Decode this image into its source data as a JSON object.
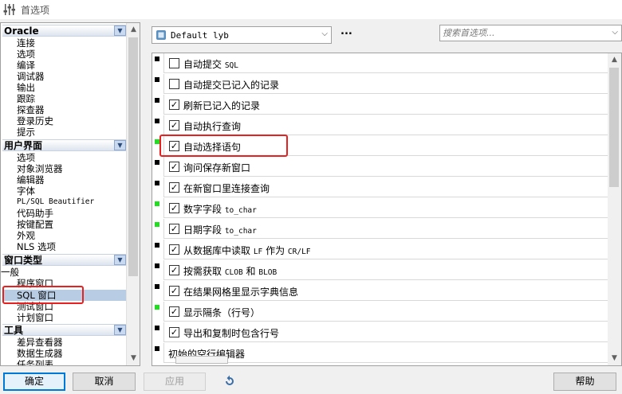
{
  "window": {
    "title": "首选项"
  },
  "tree": {
    "groups": [
      {
        "label": "Oracle",
        "items": [
          "连接",
          "选项",
          "编译",
          "调试器",
          "输出",
          "跟踪",
          "探查器",
          "登录历史",
          "提示"
        ]
      },
      {
        "label": "用户界面",
        "items": [
          "选项",
          "对象浏览器",
          "编辑器",
          "字体",
          "PL/SQL Beautifier",
          "代码助手",
          "按键配置",
          "外观",
          "NLS 选项"
        ]
      },
      {
        "label": "窗口类型",
        "sub": "一般",
        "items": [
          "程序窗口",
          "SQL 窗口",
          "测试窗口",
          "计划窗口"
        ],
        "selected": "SQL 窗口"
      },
      {
        "label": "工具",
        "items": [
          "差异查看器",
          "数据生成器",
          "任务列表"
        ]
      }
    ]
  },
  "profile": {
    "selected": "Default lyb",
    "more": "..."
  },
  "search": {
    "placeholder": "搜索首选项..."
  },
  "options": [
    {
      "label": "自动提交 SQL",
      "checked": false,
      "marker": "black"
    },
    {
      "label": "自动提交已记入的记录",
      "checked": false,
      "marker": "black"
    },
    {
      "label": "刷新已记入的记录",
      "checked": true,
      "marker": "black"
    },
    {
      "label": "自动执行查询",
      "checked": true,
      "marker": "black"
    },
    {
      "label": "自动选择语句",
      "checked": true,
      "marker": "green"
    },
    {
      "label": "询问保存新窗口",
      "checked": true,
      "marker": "black"
    },
    {
      "label": "在新窗口里连接查询",
      "checked": true,
      "marker": "black"
    },
    {
      "label": "数字字段 to_char",
      "checked": true,
      "marker": "green"
    },
    {
      "label": "日期字段 to_char",
      "checked": true,
      "marker": "green"
    },
    {
      "label": "从数据库中读取 LF 作为 CR/LF",
      "checked": true,
      "marker": "black"
    },
    {
      "label": "按需获取 CLOB 和 BLOB",
      "checked": true,
      "marker": "black"
    },
    {
      "label": "在结果网格里显示字典信息",
      "checked": true,
      "marker": "black"
    },
    {
      "label": "显示隔条（行号）",
      "checked": true,
      "marker": "green"
    },
    {
      "label": "导出和复制时包含行号",
      "checked": true,
      "marker": "black"
    },
    {
      "label": "初始的空行编辑器",
      "checked": null,
      "marker": "black"
    }
  ],
  "buttons": {
    "ok": "确定",
    "cancel": "取消",
    "apply": "应用",
    "help": "帮助"
  },
  "colors": {
    "highlight": "#e82020",
    "marker_green": "#22dd22",
    "selection": "#b8cce4",
    "primary_border": "#0078d7"
  }
}
